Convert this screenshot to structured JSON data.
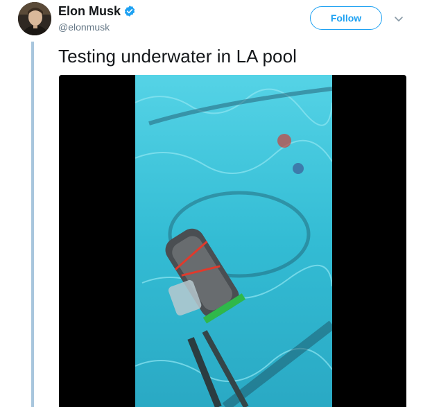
{
  "author": {
    "display_name": "Elon Musk",
    "handle": "@elonmusk",
    "verified": true,
    "avatar_icon": "profile-photo"
  },
  "actions": {
    "follow_label": "Follow",
    "more_icon": "chevron-down-icon"
  },
  "tweet": {
    "text": "Testing underwater in LA pool"
  },
  "colors": {
    "accent": "#1da1f2",
    "thread_line": "#a8c6dd",
    "text_primary": "#14171a",
    "text_secondary": "#657786",
    "pool_water": "#3fc3d9"
  }
}
